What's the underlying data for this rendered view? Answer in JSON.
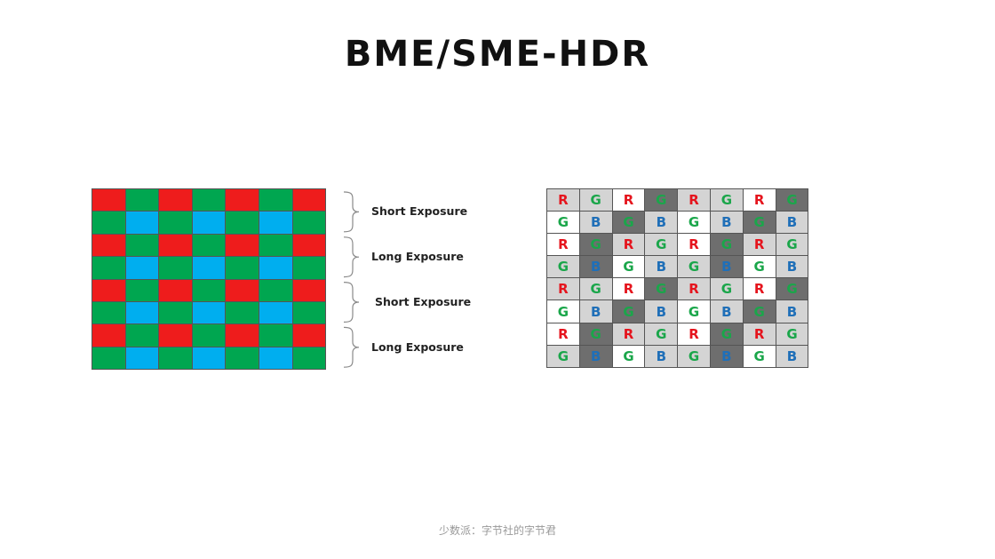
{
  "title": "BME/SME-HDR",
  "source": "少数派：字节社的字节君",
  "colors": {
    "red": "#ee1c1c",
    "green": "#00a650",
    "blue": "#00aeef",
    "letter_R": "#e5141d",
    "letter_G": "#1aa64a",
    "letter_B": "#1f6fb8",
    "cell_white": "#ffffff",
    "cell_light": "#d4d4d4",
    "cell_dark": "#6e6e6e"
  },
  "left_diagram": {
    "rows": [
      [
        "R",
        "G",
        "R",
        "G",
        "R",
        "G",
        "R"
      ],
      [
        "G",
        "B",
        "G",
        "B",
        "G",
        "B",
        "G"
      ],
      [
        "R",
        "G",
        "R",
        "G",
        "R",
        "G",
        "R"
      ],
      [
        "G",
        "B",
        "G",
        "B",
        "G",
        "B",
        "G"
      ],
      [
        "R",
        "G",
        "R",
        "G",
        "R",
        "G",
        "R"
      ],
      [
        "G",
        "B",
        "G",
        "B",
        "G",
        "B",
        "G"
      ],
      [
        "R",
        "G",
        "R",
        "G",
        "R",
        "G",
        "R"
      ],
      [
        "G",
        "B",
        "G",
        "B",
        "G",
        "B",
        "G"
      ]
    ],
    "exposure_labels": [
      "Short Exposure",
      "Long Exposure",
      "Short Exposure",
      "Long Exposure"
    ]
  },
  "right_diagram": {
    "letters": [
      [
        "R",
        "G",
        "R",
        "G",
        "R",
        "G",
        "R",
        "G"
      ],
      [
        "G",
        "B",
        "G",
        "B",
        "G",
        "B",
        "G",
        "B"
      ],
      [
        "R",
        "G",
        "R",
        "G",
        "R",
        "G",
        "R",
        "G"
      ],
      [
        "G",
        "B",
        "G",
        "B",
        "G",
        "B",
        "G",
        "B"
      ],
      [
        "R",
        "G",
        "R",
        "G",
        "R",
        "G",
        "R",
        "G"
      ],
      [
        "G",
        "B",
        "G",
        "B",
        "G",
        "B",
        "G",
        "B"
      ],
      [
        "R",
        "G",
        "R",
        "G",
        "R",
        "G",
        "R",
        "G"
      ],
      [
        "G",
        "B",
        "G",
        "B",
        "G",
        "B",
        "G",
        "B"
      ]
    ],
    "shades": [
      [
        "L",
        "L",
        "W",
        "D",
        "L",
        "L",
        "W",
        "D"
      ],
      [
        "W",
        "L",
        "D",
        "L",
        "W",
        "L",
        "D",
        "L"
      ],
      [
        "W",
        "D",
        "L",
        "L",
        "W",
        "D",
        "L",
        "L"
      ],
      [
        "L",
        "D",
        "W",
        "L",
        "L",
        "D",
        "W",
        "L"
      ],
      [
        "L",
        "L",
        "W",
        "D",
        "L",
        "L",
        "W",
        "D"
      ],
      [
        "W",
        "L",
        "D",
        "L",
        "W",
        "L",
        "D",
        "L"
      ],
      [
        "W",
        "D",
        "L",
        "L",
        "W",
        "D",
        "L",
        "L"
      ],
      [
        "L",
        "D",
        "W",
        "L",
        "L",
        "D",
        "W",
        "L"
      ]
    ]
  }
}
